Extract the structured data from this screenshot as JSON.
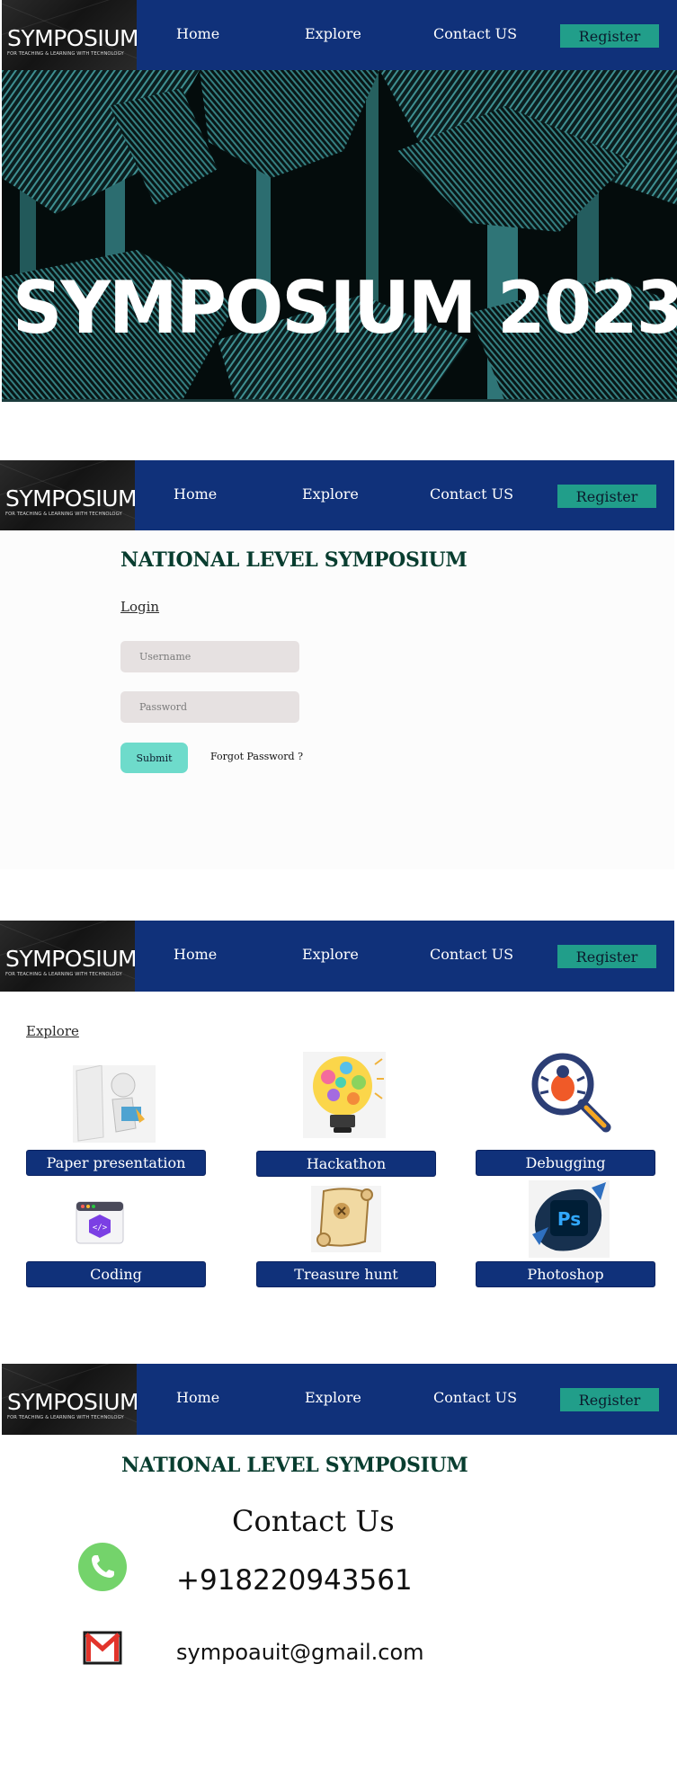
{
  "nav": {
    "logo_title": "SYMPOSIUM",
    "logo_subtitle": "FOR TEACHING & LEARNING WITH TECHNOLOGY",
    "home": "Home",
    "explore": "Explore",
    "contact": "Contact US",
    "register": "Register"
  },
  "hero": {
    "title": "SYMPOSIUM 2023"
  },
  "login": {
    "heading": "NATIONAL LEVEL SYMPOSIUM",
    "title": "Login",
    "username_placeholder": "Username",
    "password_placeholder": "Password",
    "submit": "Submit",
    "forgot": "Forgot Password ?"
  },
  "explore": {
    "title": "Explore",
    "events": [
      {
        "label": "Paper presentation",
        "icon": "presenter-icon"
      },
      {
        "label": "Hackathon",
        "icon": "lightbulb-icon"
      },
      {
        "label": "Debugging",
        "icon": "bug-magnifier-icon"
      },
      {
        "label": "Coding",
        "icon": "code-window-icon"
      },
      {
        "label": "Treasure hunt",
        "icon": "treasure-map-icon"
      },
      {
        "label": "Photoshop",
        "icon": "photoshop-icon"
      }
    ]
  },
  "contact": {
    "heading": "NATIONAL LEVEL SYMPOSIUM",
    "title": "Contact Us",
    "phone": "+918220943561",
    "email": "sympoauit@gmail.com"
  },
  "colors": {
    "nav_bg": "#10317a",
    "register_bg": "#219e8a",
    "heading_green": "#083d2f",
    "submit_bg": "#6edbcb",
    "hero_teal": "#3b8a8c"
  }
}
